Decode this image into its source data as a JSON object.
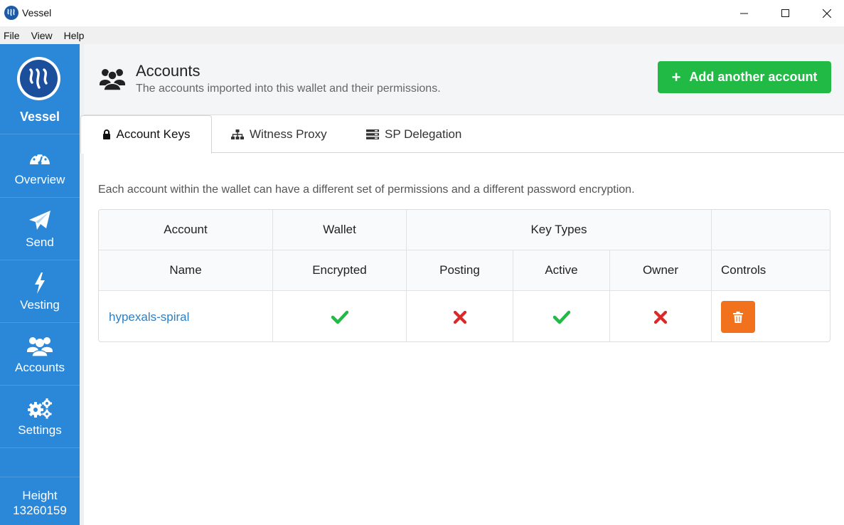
{
  "window": {
    "title": "Vessel",
    "icon": "steem-logo-icon",
    "controls": [
      "minimize-icon",
      "maximize-icon",
      "close-icon"
    ]
  },
  "menu": {
    "items": [
      "File",
      "View",
      "Help"
    ]
  },
  "sidebar": {
    "brand": "Vessel",
    "items": [
      {
        "label": "Overview",
        "icon": "gauge-icon"
      },
      {
        "label": "Send",
        "icon": "paper-plane-icon"
      },
      {
        "label": "Vesting",
        "icon": "lightning-icon"
      },
      {
        "label": "Accounts",
        "icon": "users-icon"
      },
      {
        "label": "Settings",
        "icon": "gears-icon"
      }
    ],
    "height_label": "Height",
    "height_value": "13260159",
    "color": "#2b88d8"
  },
  "header": {
    "title": "Accounts",
    "subtitle": "The accounts imported into this wallet and their permissions.",
    "add_button": "Add another account",
    "add_button_color": "#21ba45"
  },
  "tabs": [
    {
      "label": "Account Keys",
      "icon": "lock-icon",
      "active": true
    },
    {
      "label": "Witness Proxy",
      "icon": "sitemap-icon",
      "active": false
    },
    {
      "label": "SP Delegation",
      "icon": "server-icon",
      "active": false
    }
  ],
  "description": "Each account within the wallet can have a different set of permissions and a different password encryption.",
  "table": {
    "group_headers": [
      "Account",
      "Wallet",
      "Key Types",
      ""
    ],
    "columns": [
      "Name",
      "Encrypted",
      "Posting",
      "Active",
      "Owner",
      "Controls"
    ],
    "rows": [
      {
        "name": "hypexals-spiral",
        "encrypted": true,
        "posting": false,
        "active": true,
        "owner": false
      }
    ],
    "check_color": "#21ba45",
    "cross_color": "#db2828",
    "delete_color": "#f2711c"
  }
}
